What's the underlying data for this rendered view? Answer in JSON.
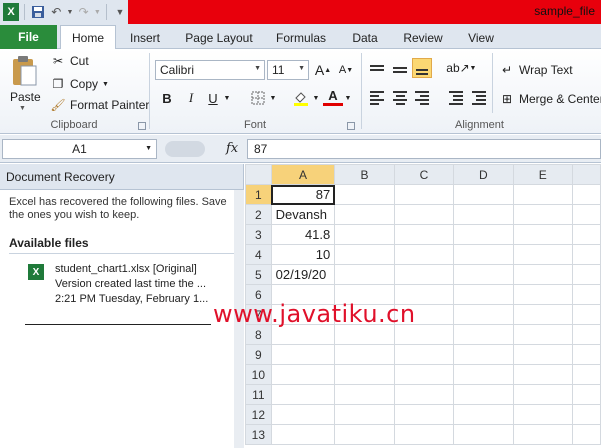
{
  "window": {
    "title": "sample_file",
    "qat": [
      "excel-logo-icon",
      "save-icon",
      "undo-icon",
      "redo-icon",
      "customize-qat-icon"
    ]
  },
  "tabs": [
    {
      "label": "File"
    },
    {
      "label": "Home"
    },
    {
      "label": "Insert"
    },
    {
      "label": "Page Layout"
    },
    {
      "label": "Formulas"
    },
    {
      "label": "Data"
    },
    {
      "label": "Review"
    },
    {
      "label": "View"
    }
  ],
  "ribbon": {
    "clipboard": {
      "paste": "Paste",
      "cut": "Cut",
      "copy": "Copy",
      "format_painter": "Format Painter",
      "label": "Clipboard"
    },
    "font": {
      "name": "Calibri",
      "size": "11",
      "bold": "B",
      "italic": "I",
      "underline": "U",
      "color_letter": "A",
      "label": "Font"
    },
    "alignment": {
      "wrap_text": "Wrap Text",
      "merge_center": "Merge & Center",
      "label": "Alignment"
    }
  },
  "formula_bar": {
    "name_box": "A1",
    "fx": "fx",
    "value": "87"
  },
  "recovery": {
    "header": "Document Recovery",
    "message": "Excel has recovered the following files.  Save the ones you wish to keep.",
    "available_label": "Available files",
    "file": {
      "name": "student_chart1.xlsx  [Original]",
      "desc": "Version created last time the ...",
      "time": "2:21 PM Tuesday, February 1..."
    }
  },
  "sheet": {
    "columns": [
      "A",
      "B",
      "C",
      "D",
      "E"
    ],
    "rows": [
      {
        "n": "1",
        "a": "87"
      },
      {
        "n": "2",
        "a": "Devansh"
      },
      {
        "n": "3",
        "a": "41.8"
      },
      {
        "n": "4",
        "a": "10"
      },
      {
        "n": "5",
        "a": "02/19/20"
      },
      {
        "n": "6",
        "a": ""
      },
      {
        "n": "7",
        "a": ""
      },
      {
        "n": "8",
        "a": ""
      },
      {
        "n": "9",
        "a": ""
      },
      {
        "n": "10",
        "a": ""
      },
      {
        "n": "11",
        "a": ""
      },
      {
        "n": "12",
        "a": ""
      },
      {
        "n": "13",
        "a": ""
      }
    ]
  },
  "watermark": "www.javatiku.cn"
}
